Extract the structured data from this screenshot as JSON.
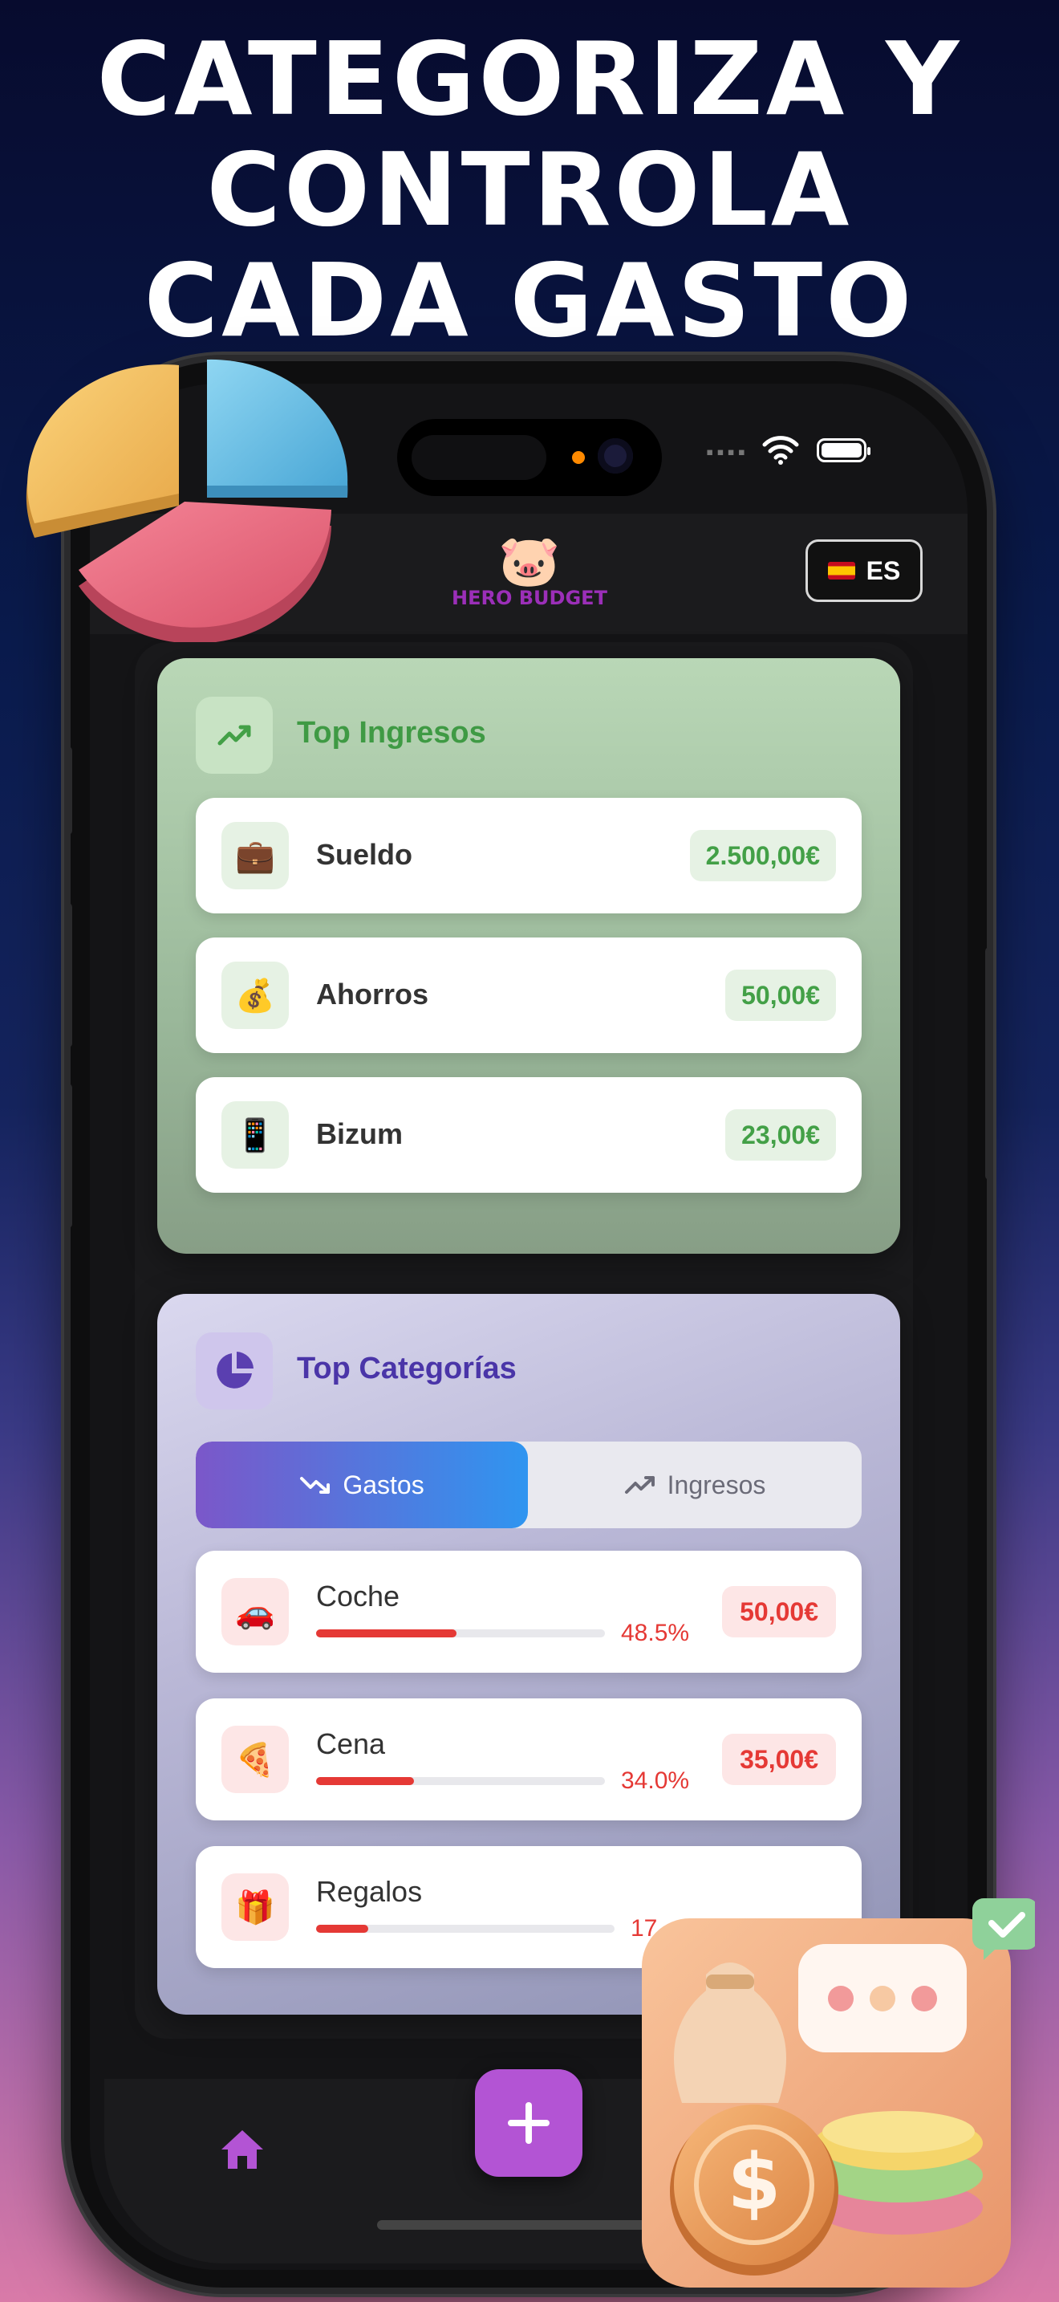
{
  "headline": [
    "CATEGORIZA Y",
    "CONTROLA",
    "CADA GASTO"
  ],
  "app": {
    "brand": "HERO BUDGET",
    "language": "ES"
  },
  "top_ingresos": {
    "title": "Top Ingresos",
    "items": [
      {
        "icon": "briefcase-icon",
        "emoji": "💼",
        "label": "Sueldo",
        "amount": "2.500,00€"
      },
      {
        "icon": "money-bag-icon",
        "emoji": "💰",
        "label": "Ahorros",
        "amount": "50,00€"
      },
      {
        "icon": "mobile-phone-icon",
        "emoji": "📱",
        "label": "Bizum",
        "amount": "23,00€"
      }
    ]
  },
  "top_categorias": {
    "title": "Top Categorías",
    "tabs": {
      "active": "Gastos",
      "inactive": "Ingresos"
    },
    "items": [
      {
        "icon": "car-icon",
        "emoji": "🚗",
        "label": "Coche",
        "percent_label": "48.5%",
        "share": 0.485,
        "amount": "50,00€"
      },
      {
        "icon": "pizza-icon",
        "emoji": "🍕",
        "label": "Cena",
        "percent_label": "34.0%",
        "share": 0.34,
        "amount": "35,00€"
      },
      {
        "icon": "gift-icon",
        "emoji": "🎁",
        "label": "Regalos",
        "percent_label": "17",
        "share": 0.175,
        "amount": ""
      }
    ]
  },
  "colors": {
    "income": "#43a047",
    "expense": "#e53935",
    "fab": "#b354d4",
    "brand": "#9b2fb8"
  }
}
